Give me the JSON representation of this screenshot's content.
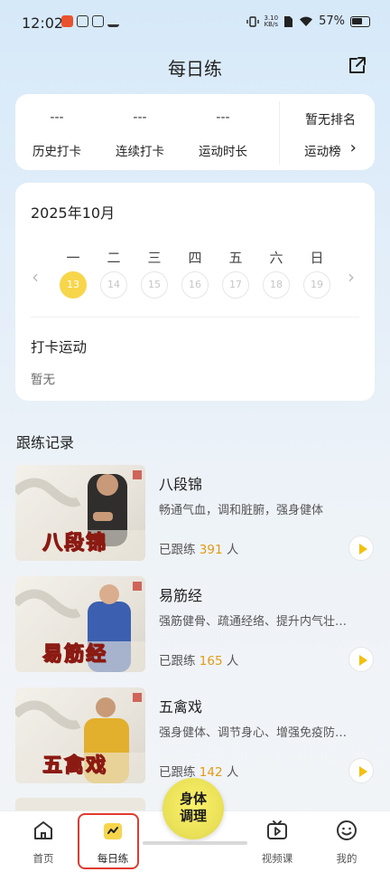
{
  "status_bar": {
    "time": "12:02",
    "speed": "3.10\nKB/s",
    "battery": "57%"
  },
  "header": {
    "title": "每日练",
    "share_icon": "share-icon"
  },
  "stats": {
    "history_value": "---",
    "history_label": "历史打卡",
    "streak_value": "---",
    "streak_label": "连续打卡",
    "duration_value": "---",
    "duration_label": "运动时长",
    "rank_value": "暂无排名",
    "rank_label": "运动榜",
    "rank_arrow": "›"
  },
  "calendar": {
    "month": "2025年10月",
    "weekdays": [
      "一",
      "二",
      "三",
      "四",
      "五",
      "六",
      "日"
    ],
    "days": [
      "13",
      "14",
      "15",
      "16",
      "17",
      "18",
      "19"
    ],
    "active_day": "13",
    "prev_arrow": "‹",
    "next_arrow": "›",
    "checkin_title": "打卡运动",
    "checkin_empty": "暂无"
  },
  "records": {
    "title": "跟练记录",
    "items": [
      {
        "thumb_text": "八段锦",
        "title": "八段锦",
        "desc": "畅通气血，调和脏腑，强身健体",
        "count_prefix": "已跟练",
        "count": "391",
        "count_suffix": "人"
      },
      {
        "thumb_text": "易筋经",
        "title": "易筋经",
        "desc": "强筋健骨、疏通经络、提升内气壮…",
        "count_prefix": "已跟练",
        "count": "165",
        "count_suffix": "人"
      },
      {
        "thumb_text": "五禽戏",
        "title": "五禽戏",
        "desc": "强身健体、调节身心、增强免疫防…",
        "count_prefix": "已跟练",
        "count": "142",
        "count_suffix": "人"
      }
    ]
  },
  "bottom_nav": {
    "home": "首页",
    "daily": "每日练",
    "center_line1": "身体",
    "center_line2": "调理",
    "video": "视频课",
    "mine": "我的"
  },
  "colors": {
    "accent_yellow": "#f7d64c",
    "count_orange": "#e59a11",
    "highlight_red": "#e03b2e"
  }
}
